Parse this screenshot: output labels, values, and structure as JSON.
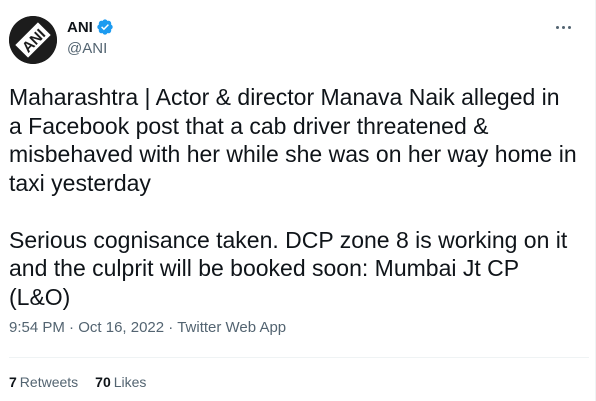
{
  "author": {
    "display_name": "ANI",
    "handle": "@ANI",
    "avatar_icon": "ani-logo-icon",
    "verified": true,
    "verified_color": "#1d9bf0"
  },
  "tweet": {
    "paragraph1": "Maharashtra | Actor & director Manava Naik alleged in\na Facebook post that a cab driver threatened &\nmisbehaved with her while she was on her way home in\ntaxi yesterday",
    "paragraph2": "Serious cognisance taken. DCP zone 8 is working on it\nand the culprit will be booked soon: Mumbai Jt CP\n(L&O)",
    "time": "9:54 PM",
    "date": "Oct 16, 2022",
    "source": "Twitter Web App"
  },
  "stats": {
    "retweets_count": "7",
    "retweets_label": "Retweets",
    "likes_count": "70",
    "likes_label": "Likes"
  },
  "menu_icon": "more-options-icon"
}
